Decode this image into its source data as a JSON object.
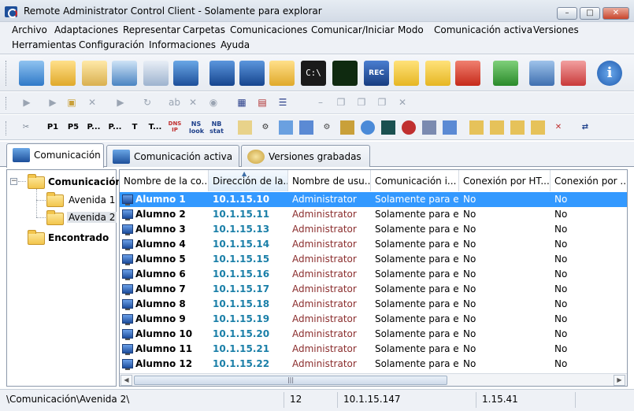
{
  "window": {
    "title": "Remote Administrator Control Client - Solamente para explorar"
  },
  "menu": {
    "row1": [
      "Archivo",
      "Adaptaciones",
      "Representar",
      "Carpetas",
      "Comunicaciones",
      "Comunicar/Iniciar",
      "Modo",
      "Comunicación activa",
      "Versiones"
    ],
    "row2": [
      "Herramientas",
      "Configuración",
      "Informaciones",
      "Ayuda"
    ]
  },
  "toolbar3_labels": [
    "P1",
    "P5",
    "P...",
    "P...",
    "T",
    "T...",
    "DNS IP",
    "NS look",
    "NB stat"
  ],
  "tabs": [
    "Comunicación",
    "Comunicación activa",
    "Versiones grabadas"
  ],
  "tree": {
    "root": "Comunicación",
    "children": [
      "Avenida 1",
      "Avenida 2"
    ],
    "other": "Encontrado"
  },
  "columns": [
    "Nombre de la co...",
    "Dirección de la...",
    "Nombre de usu...",
    "Comunicación i...",
    "Conexión por HT...",
    "Conexión por ..."
  ],
  "rows": [
    {
      "name": "Alumno 1",
      "ip": "10.1.15.10",
      "user": "Administrator",
      "mode": "Solamente para e...",
      "http": "No",
      "other": "No"
    },
    {
      "name": "Alumno 2",
      "ip": "10.1.15.11",
      "user": "Administrator",
      "mode": "Solamente para e...",
      "http": "No",
      "other": "No"
    },
    {
      "name": "Alumno 3",
      "ip": "10.1.15.13",
      "user": "Administrator",
      "mode": "Solamente para e...",
      "http": "No",
      "other": "No"
    },
    {
      "name": "Alumno 4",
      "ip": "10.1.15.14",
      "user": "Administrator",
      "mode": "Solamente para e...",
      "http": "No",
      "other": "No"
    },
    {
      "name": "Alumno 5",
      "ip": "10.1.15.15",
      "user": "Administrator",
      "mode": "Solamente para e...",
      "http": "No",
      "other": "No"
    },
    {
      "name": "Alumno 6",
      "ip": "10.1.15.16",
      "user": "Administrator",
      "mode": "Solamente para e...",
      "http": "No",
      "other": "No"
    },
    {
      "name": "Alumno 7",
      "ip": "10.1.15.17",
      "user": "Administrator",
      "mode": "Solamente para e...",
      "http": "No",
      "other": "No"
    },
    {
      "name": "Alumno 8",
      "ip": "10.1.15.18",
      "user": "Administrator",
      "mode": "Solamente para e...",
      "http": "No",
      "other": "No"
    },
    {
      "name": "Alumno 9",
      "ip": "10.1.15.19",
      "user": "Administrator",
      "mode": "Solamente para e...",
      "http": "No",
      "other": "No"
    },
    {
      "name": "Alumno 10",
      "ip": "10.1.15.20",
      "user": "Administrator",
      "mode": "Solamente para e...",
      "http": "No",
      "other": "No"
    },
    {
      "name": "Alumno 11",
      "ip": "10.1.15.21",
      "user": "Administrator",
      "mode": "Solamente para e...",
      "http": "No",
      "other": "No"
    },
    {
      "name": "Alumno 12",
      "ip": "10.1.15.22",
      "user": "Administrator",
      "mode": "Solamente para e...",
      "http": "No",
      "other": "No"
    }
  ],
  "status": {
    "path": "\\Comunicación\\Avenida 2\\",
    "count": "12",
    "ip": "10.1.15.147",
    "version": "1.15.41"
  },
  "colors": {
    "selection": "#3399ff",
    "ip_text": "#1a7fa8",
    "user_text": "#8b2d2d"
  }
}
